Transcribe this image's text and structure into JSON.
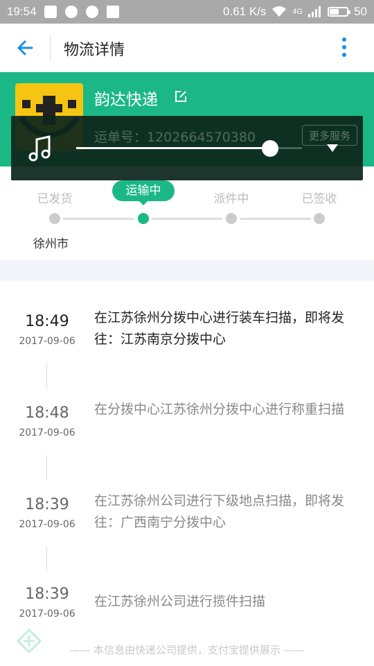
{
  "status_bar": {
    "time": "19:54",
    "speed": "0.61 K/s",
    "network": "4G",
    "battery": "50",
    "battery_level": 0.5
  },
  "header": {
    "title": "物流详情",
    "back_icon": "back-arrow-icon",
    "more_icon": "more-vertical-icon"
  },
  "carrier": {
    "name": "韵达快递",
    "waybill": "运单号：1202664570380",
    "more_services": "更多服务"
  },
  "media_player": {
    "progress": 0.86,
    "icon": "music-note-icon"
  },
  "progress_steps": [
    {
      "label": "已发货",
      "city": "徐州市"
    },
    {
      "label": "运输中",
      "active": true
    },
    {
      "label": "派件中"
    },
    {
      "label": "已签收"
    }
  ],
  "events": [
    {
      "time": "18:49",
      "date": "2017-09-06",
      "text": "在江苏徐州分拨中心进行装车扫描，即将发往：江苏南京分拨中心"
    },
    {
      "time": "18:48",
      "date": "2017-09-06",
      "text": "在分拨中心江苏徐州分拨中心进行称重扫描"
    },
    {
      "time": "18:39",
      "date": "2017-09-06",
      "text": "在江苏徐州公司进行下级地点扫描，即将发往：广西南宁分拨中心"
    },
    {
      "time": "18:39",
      "date": "2017-09-06",
      "text": "在江苏徐州公司进行揽件扫描"
    }
  ],
  "footer": "—— 本信息由快递公司提供，支付宝提供展示 ——",
  "colors": {
    "accent": "#1bb886",
    "link": "#1a8ee0",
    "logo": "#f6c512"
  }
}
